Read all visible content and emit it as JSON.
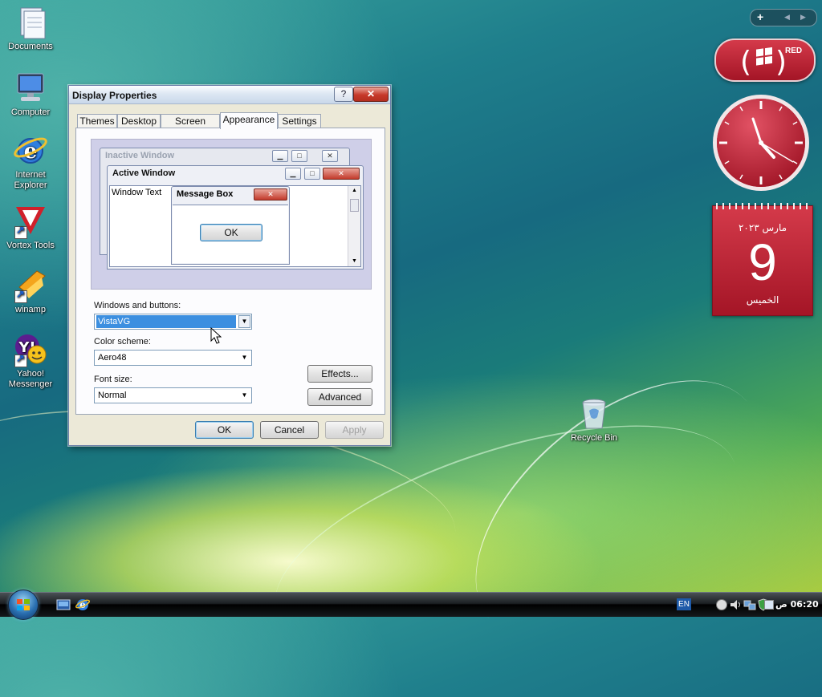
{
  "desktop_icons": [
    {
      "label": "Documents",
      "icon": "documents-icon"
    },
    {
      "label": "Computer",
      "icon": "computer-icon"
    },
    {
      "label": "Internet Explorer",
      "icon": "ie-icon"
    },
    {
      "label": "Vortex Tools",
      "icon": "vortex-icon"
    },
    {
      "label": "winamp",
      "icon": "winamp-icon"
    },
    {
      "label": "Yahoo! Messenger",
      "icon": "yahoo-icon"
    },
    {
      "label": "Recycle Bin",
      "icon": "recycle-bin-icon"
    }
  ],
  "dialog": {
    "title": "Display Properties",
    "help_glyph": "?",
    "close_glyph": "✕",
    "tabs": [
      "Themes",
      "Desktop",
      "Screen Saver",
      "Appearance",
      "Settings"
    ],
    "selected_tab": "Appearance",
    "preview": {
      "inactive_title": "Inactive Window",
      "active_title": "Active Window",
      "window_text": "Window Text",
      "message_title": "Message Box",
      "ok": "OK"
    },
    "windows_buttons_label": "Windows and buttons:",
    "windows_buttons_value": "VistaVG",
    "color_scheme_label": "Color scheme:",
    "color_scheme_value": "Aero48",
    "font_size_label": "Font size:",
    "font_size_value": "Normal",
    "effects_button": "Effects...",
    "advanced_button": "Advanced",
    "ok_button": "OK",
    "cancel_button": "Cancel",
    "apply_button": "Apply"
  },
  "gadgets": {
    "sidebar_controls": {
      "add": "+",
      "prev": "◀",
      "next": "▶"
    },
    "red_label": "RED",
    "calendar": {
      "month": "مارس ٢٠٢٣",
      "day": "9",
      "weekday": "الخميس"
    }
  },
  "taskbar": {
    "language": "EN",
    "time": "06:20 ص"
  },
  "colors": {
    "selection": "#3c8fe0",
    "gadget_red": "#b71c2c",
    "close_red": "#c6392a"
  }
}
